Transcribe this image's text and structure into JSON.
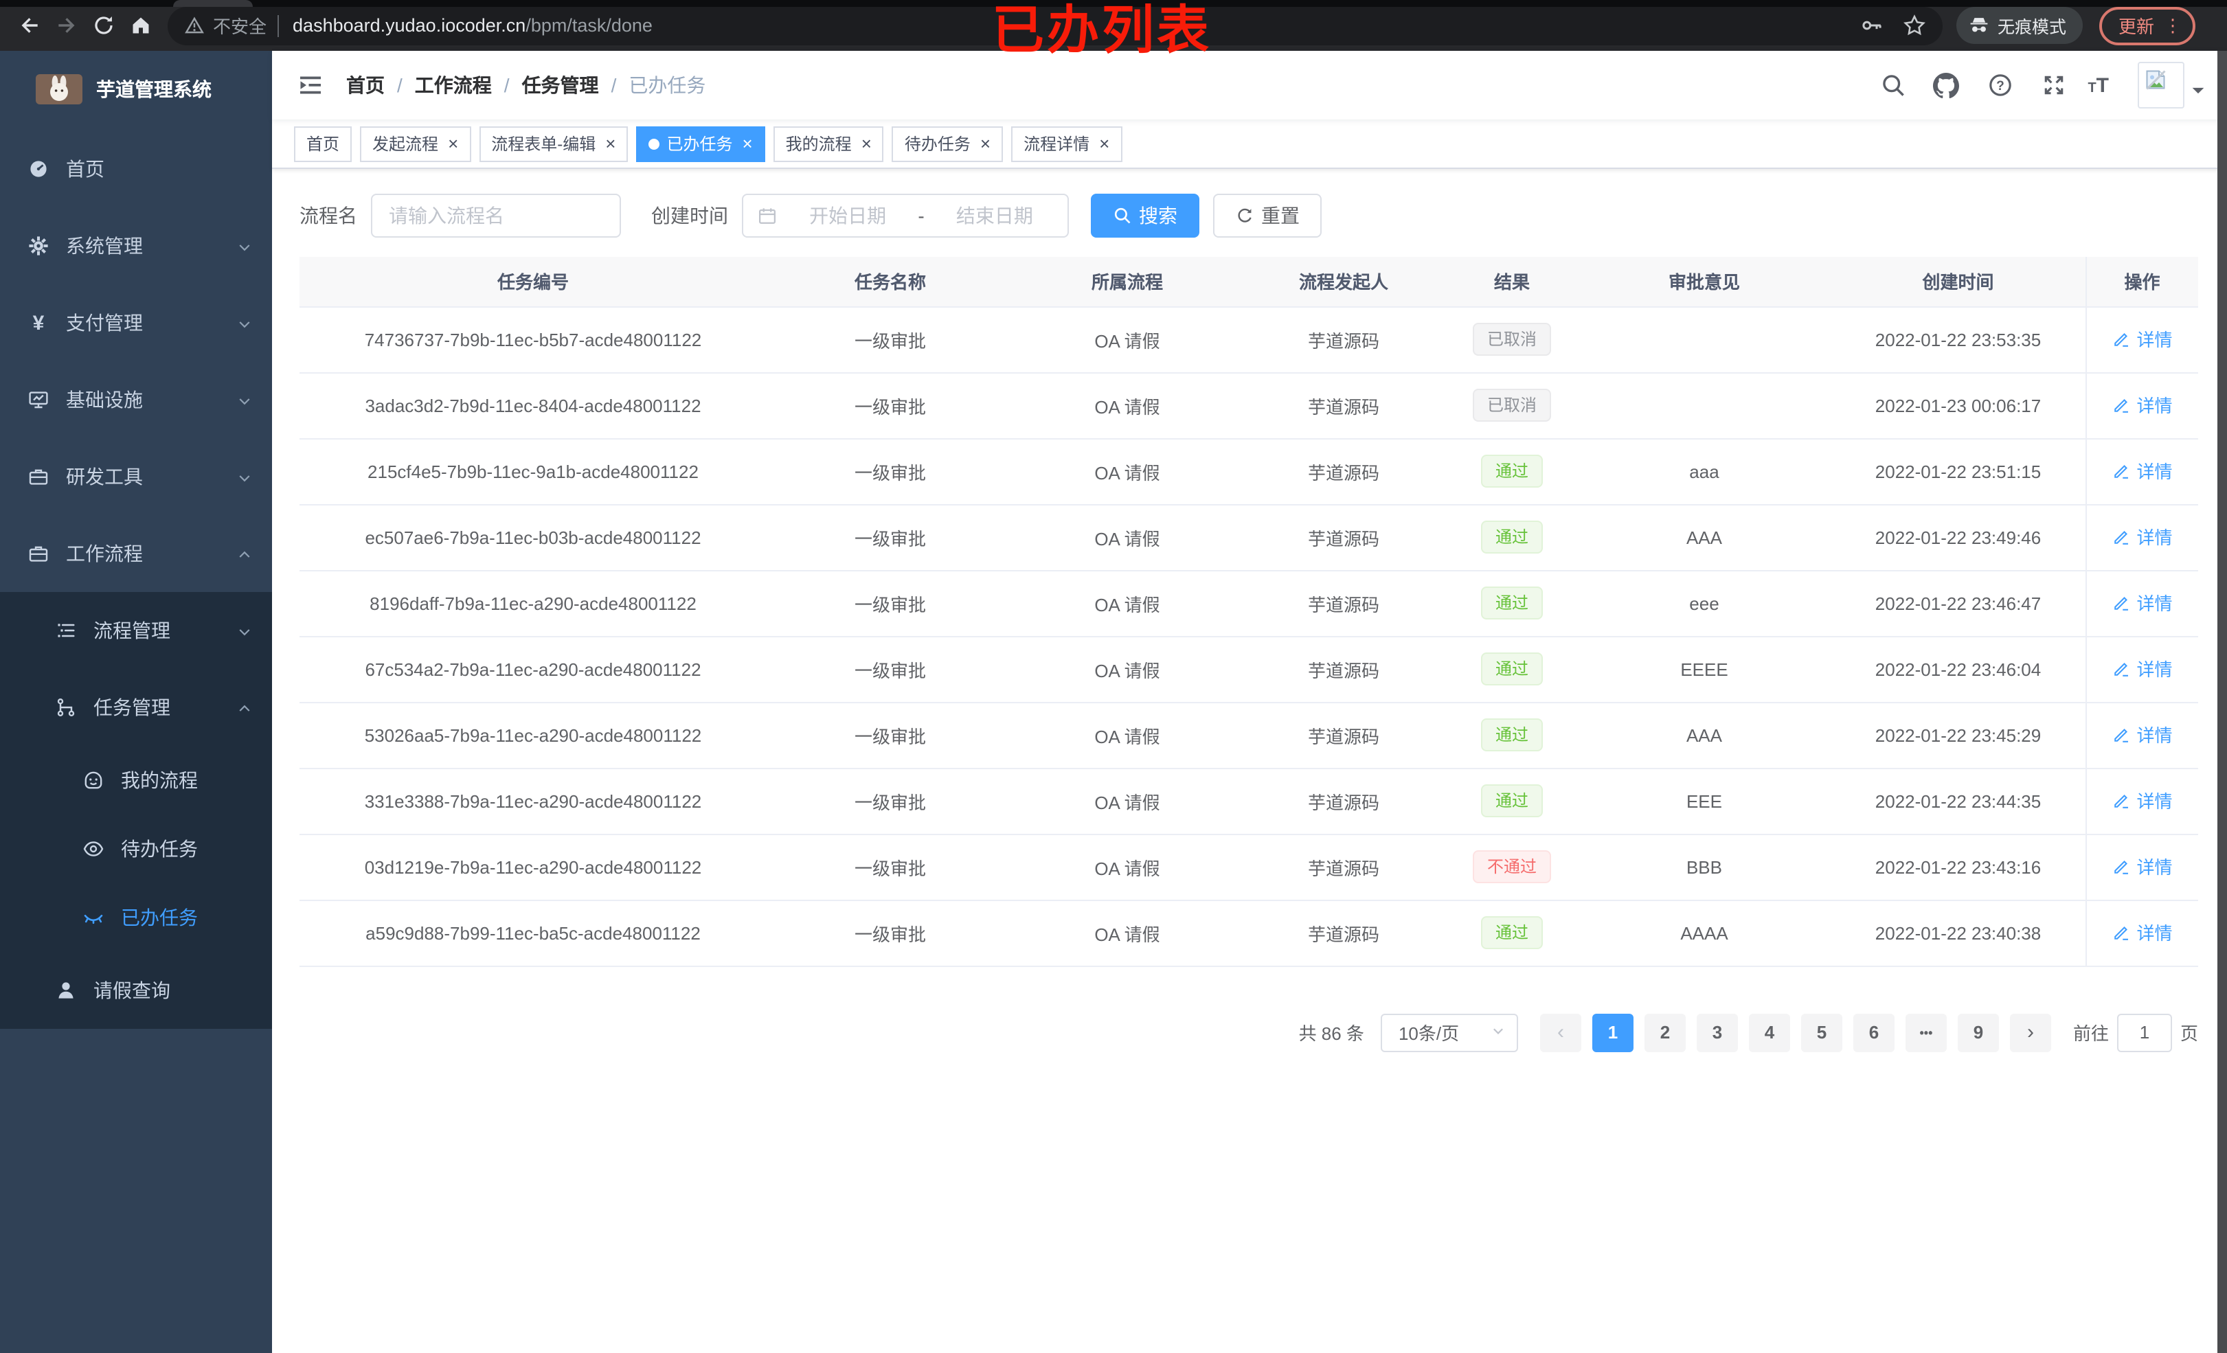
{
  "colors": {
    "accent": "#409eff",
    "success": "#67c23a",
    "danger": "#f56c6c",
    "info": "#909399",
    "annotation_red": "#f81c09",
    "sidebar_bg": "#304156",
    "submenu_bg": "#1f2d3d"
  },
  "browser": {
    "security_label": "不安全",
    "url_host": "dashboard.yudao.iocoder.cn",
    "url_path": "/bpm/task/done",
    "incognito_label": "无痕模式",
    "update_label": "更新",
    "annotation": "已办列表"
  },
  "sidebar": {
    "app_title": "芋道管理系统",
    "items": [
      {
        "label": "首页"
      },
      {
        "label": "系统管理"
      },
      {
        "label": "支付管理"
      },
      {
        "label": "基础设施"
      },
      {
        "label": "研发工具"
      },
      {
        "label": "工作流程"
      },
      {
        "label": "流程管理"
      },
      {
        "label": "任务管理"
      },
      {
        "label": "我的流程"
      },
      {
        "label": "待办任务"
      },
      {
        "label": "已办任务"
      },
      {
        "label": "请假查询"
      }
    ]
  },
  "header": {
    "breadcrumb": [
      "首页",
      "工作流程",
      "任务管理",
      "已办任务"
    ]
  },
  "tabs": [
    {
      "label": "首页",
      "closable": false,
      "active": false
    },
    {
      "label": "发起流程",
      "closable": true,
      "active": false
    },
    {
      "label": "流程表单-编辑",
      "closable": true,
      "active": false
    },
    {
      "label": "已办任务",
      "closable": true,
      "active": true
    },
    {
      "label": "我的流程",
      "closable": true,
      "active": false
    },
    {
      "label": "待办任务",
      "closable": true,
      "active": false
    },
    {
      "label": "流程详情",
      "closable": true,
      "active": false
    }
  ],
  "filters": {
    "name_label": "流程名",
    "name_placeholder": "请输入流程名",
    "time_label": "创建时间",
    "start_placeholder": "开始日期",
    "range_separator": "-",
    "end_placeholder": "结束日期",
    "search_label": "搜索",
    "reset_label": "重置"
  },
  "table": {
    "columns": [
      "任务编号",
      "任务名称",
      "所属流程",
      "流程发起人",
      "结果",
      "审批意见",
      "创建时间",
      "操作"
    ],
    "action_label": "详情",
    "rows": [
      {
        "id": "74736737-7b9b-11ec-b5b7-acde48001122",
        "task": "一级审批",
        "process": "OA 请假",
        "starter": "芋道源码",
        "result": "已取消",
        "result_type": "info",
        "comment": "",
        "created": "2022-01-22 23:53:35"
      },
      {
        "id": "3adac3d2-7b9d-11ec-8404-acde48001122",
        "task": "一级审批",
        "process": "OA 请假",
        "starter": "芋道源码",
        "result": "已取消",
        "result_type": "info",
        "comment": "",
        "created": "2022-01-23 00:06:17"
      },
      {
        "id": "215cf4e5-7b9b-11ec-9a1b-acde48001122",
        "task": "一级审批",
        "process": "OA 请假",
        "starter": "芋道源码",
        "result": "通过",
        "result_type": "success",
        "comment": "aaa",
        "created": "2022-01-22 23:51:15"
      },
      {
        "id": "ec507ae6-7b9a-11ec-b03b-acde48001122",
        "task": "一级审批",
        "process": "OA 请假",
        "starter": "芋道源码",
        "result": "通过",
        "result_type": "success",
        "comment": "AAA",
        "created": "2022-01-22 23:49:46"
      },
      {
        "id": "8196daff-7b9a-11ec-a290-acde48001122",
        "task": "一级审批",
        "process": "OA 请假",
        "starter": "芋道源码",
        "result": "通过",
        "result_type": "success",
        "comment": "eee",
        "created": "2022-01-22 23:46:47"
      },
      {
        "id": "67c534a2-7b9a-11ec-a290-acde48001122",
        "task": "一级审批",
        "process": "OA 请假",
        "starter": "芋道源码",
        "result": "通过",
        "result_type": "success",
        "comment": "EEEE",
        "created": "2022-01-22 23:46:04"
      },
      {
        "id": "53026aa5-7b9a-11ec-a290-acde48001122",
        "task": "一级审批",
        "process": "OA 请假",
        "starter": "芋道源码",
        "result": "通过",
        "result_type": "success",
        "comment": "AAA",
        "created": "2022-01-22 23:45:29"
      },
      {
        "id": "331e3388-7b9a-11ec-a290-acde48001122",
        "task": "一级审批",
        "process": "OA 请假",
        "starter": "芋道源码",
        "result": "通过",
        "result_type": "success",
        "comment": "EEE",
        "created": "2022-01-22 23:44:35"
      },
      {
        "id": "03d1219e-7b9a-11ec-a290-acde48001122",
        "task": "一级审批",
        "process": "OA 请假",
        "starter": "芋道源码",
        "result": "不通过",
        "result_type": "danger",
        "comment": "BBB",
        "created": "2022-01-22 23:43:16"
      },
      {
        "id": "a59c9d88-7b99-11ec-ba5c-acde48001122",
        "task": "一级审批",
        "process": "OA 请假",
        "starter": "芋道源码",
        "result": "通过",
        "result_type": "success",
        "comment": "AAAA",
        "created": "2022-01-22 23:40:38"
      }
    ]
  },
  "pagination": {
    "total_text": "共 86 条",
    "page_size": "10条/页",
    "pages": [
      "1",
      "2",
      "3",
      "4",
      "5",
      "6",
      "•••",
      "9"
    ],
    "active_page": "1",
    "goto_label": "前往",
    "goto_value": "1",
    "goto_suffix": "页"
  }
}
